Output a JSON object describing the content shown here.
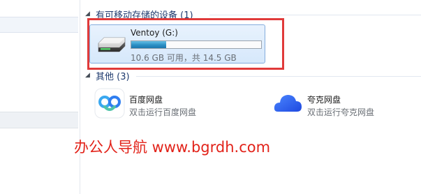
{
  "groups": {
    "removable": {
      "title": "有可移动存储的设备 (1)"
    },
    "other": {
      "title": "其他 (3)"
    }
  },
  "drive": {
    "name": "Ventoy (G:)",
    "info": "10.6 GB 可用，共 14.5 GB",
    "used_fraction": 0.27,
    "icon": "usb-drive-icon"
  },
  "apps": [
    {
      "name": "百度网盘",
      "desc": "双击运行百度网盘",
      "icon": "baidu-netdisk-icon"
    },
    {
      "name": "夸克网盘",
      "desc": "双击运行夸克网盘",
      "icon": "quark-netdisk-icon"
    }
  ],
  "watermark": "办公人导航  www.bgrdh.com",
  "colors": {
    "highlight": "#e03a3a",
    "watermark": "#e2231a",
    "group_title": "#1e3a6e",
    "tile_border": "#84acdd",
    "bar_fill": "#2b8ec4"
  }
}
